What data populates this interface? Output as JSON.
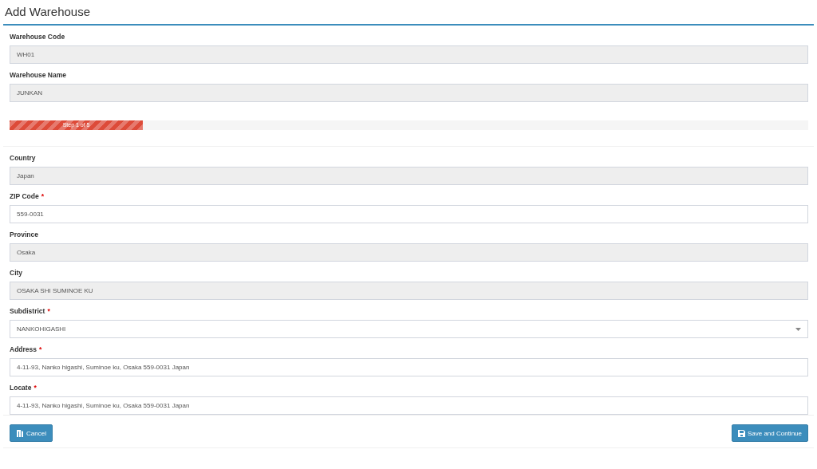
{
  "title": "Add Warehouse",
  "top_fields": [
    {
      "label": "Warehouse Code",
      "value": "WH01",
      "kind": "readonly",
      "required": false
    },
    {
      "label": "Warehouse Name",
      "value": "JUNKAN",
      "kind": "readonly",
      "required": false
    }
  ],
  "progress": {
    "label": "Step 1 of 5",
    "level": 0.167
  },
  "fields": [
    {
      "label": "Country",
      "value": "Japan",
      "kind": "readonly",
      "required": false
    },
    {
      "label": "ZIP Code",
      "value": "559-0031",
      "kind": "text",
      "required": true
    },
    {
      "label": "Province",
      "value": "Osaka",
      "kind": "readonly",
      "required": false
    },
    {
      "label": "City",
      "value": "OSAKA SHI SUMINOE KU",
      "kind": "readonly",
      "required": false
    },
    {
      "label": "Subdistrict",
      "value": "NANKOHIGASHI",
      "kind": "select",
      "required": true
    },
    {
      "label": "Address",
      "value": "4-11-93, Nanko higashi, Suminoe ku, Osaka 559-0031 Japan",
      "kind": "text",
      "required": true
    },
    {
      "label": "Locate",
      "value": "4-11-93, Nanko higashi, Suminoe ku, Osaka 559-0031 Japan",
      "kind": "text",
      "required": true
    }
  ],
  "required_mark": "*",
  "buttons": {
    "cancel": "Cancel",
    "save": "Save and Continue"
  }
}
